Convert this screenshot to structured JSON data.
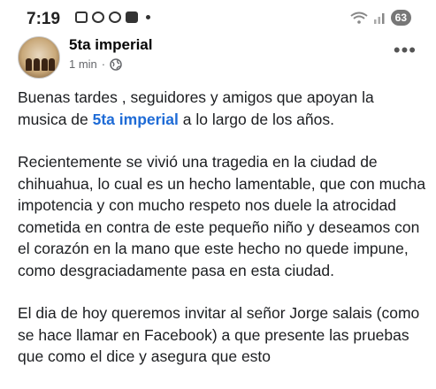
{
  "status_bar": {
    "time": "7:19",
    "battery": "63"
  },
  "post": {
    "page_name": "5ta imperial",
    "time_ago": "1 min",
    "separator": "·",
    "more_label": "•••",
    "p1_before": "Buenas tardes , seguidores y  amigos que apoyan la musica de ",
    "mention": "5ta imperial",
    "p1_after": " a lo largo de los años.",
    "p2": "Recientemente se vivió una tragedia en la ciudad de chihuahua,  lo cual es un hecho lamentable, que con mucha impotencia y con mucho respeto nos duele la atrocidad cometida en contra de este pequeño niño y deseamos con el corazón en la mano que este hecho no quede impune, como desgraciadamente pasa en esta ciudad.",
    "p3": "El dia de hoy queremos invitar al señor Jorge salais (como se hace llamar en Facebook) a que presente las pruebas que como el dice y asegura que esto"
  },
  "colors": {
    "mention": "#1e6bd6",
    "meta": "#65676b",
    "text": "#1c1e21"
  }
}
